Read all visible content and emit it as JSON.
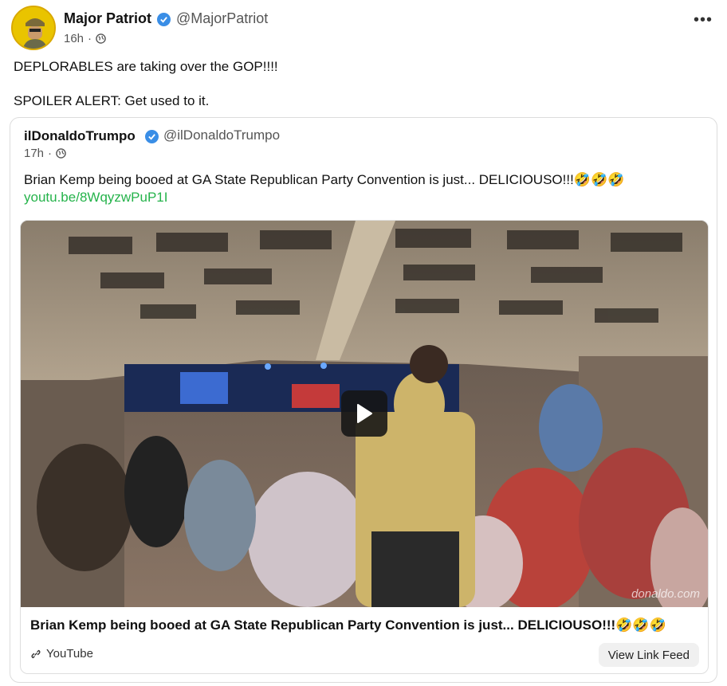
{
  "post": {
    "author_name": "Major Patriot",
    "author_handle": "@MajorPatriot",
    "time": "16h",
    "more_label": "•••",
    "text_line1": "DEPLORABLES are taking over the GOP!!!!",
    "text_line2": "SPOILER ALERT: Get used to it."
  },
  "quoted": {
    "author_name": "ilDonaldoTrumpo",
    "author_handle": "@ilDonaldoTrumpo",
    "time": "17h",
    "text": "Brian Kemp being booed at GA State Republican Party Convention is just... DELICIOUSO!!!🤣🤣🤣",
    "link": "youtu.be/8WqyzwPuP1I"
  },
  "link_preview": {
    "title": "Brian Kemp being booed at GA State Republican Party Convention is just...  DELICIOUSO!!!🤣🤣🤣",
    "source": "YouTube",
    "action_label": "View Link Feed",
    "watermark": "donaldo.com"
  },
  "icons": {
    "verified": "verified-badge-icon",
    "globe": "globe-icon",
    "more": "more-options-icon",
    "play": "play-icon",
    "link": "link-icon"
  },
  "colors": {
    "verified_blue": "#3a8ee6",
    "link_green": "#25b34b",
    "avatar_yellow": "#e9c400"
  }
}
